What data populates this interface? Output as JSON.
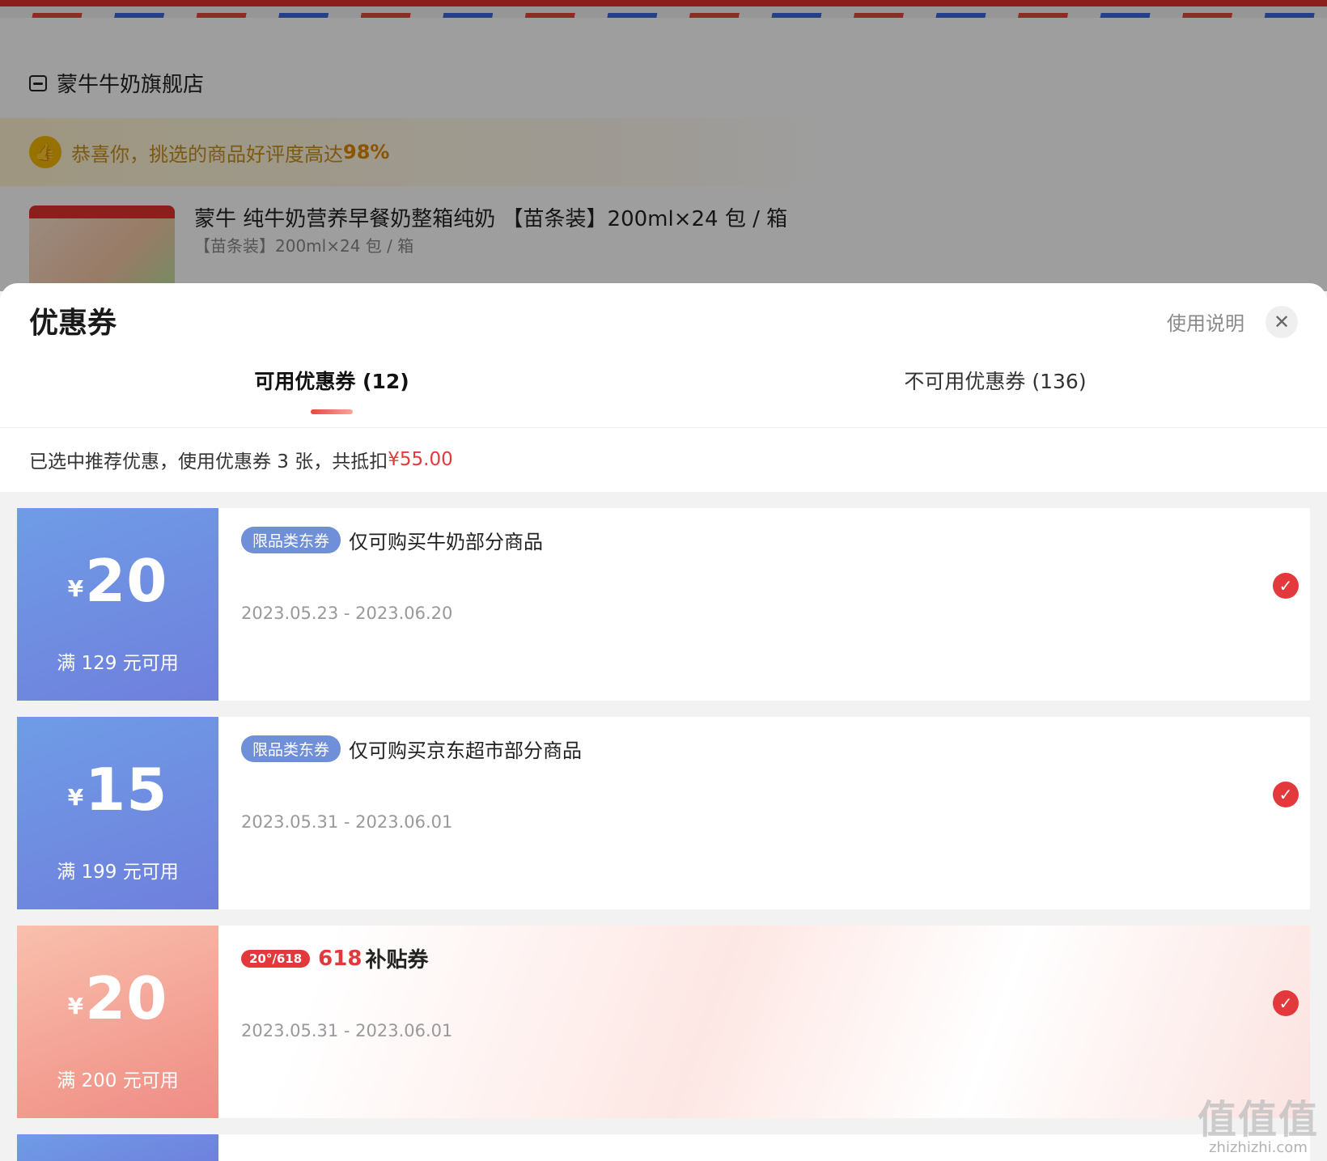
{
  "background": {
    "shop_name": "蒙牛牛奶旗舰店",
    "tip_text": "恭喜你，挑选的商品好评度高达",
    "tip_pct": "98%",
    "product_title": "蒙牛 纯牛奶营养早餐奶整箱纯奶 【苗条装】200ml×24 包 / 箱",
    "product_sub": "【苗条装】200ml×24 包 / 箱"
  },
  "sheet": {
    "title": "优惠券",
    "help_label": "使用说明",
    "close_glyph": "✕"
  },
  "tabs": [
    {
      "label": "可用优惠券 (12)",
      "active": true
    },
    {
      "label": "不可用优惠券 (136)",
      "active": false
    }
  ],
  "summary": {
    "text": "已选中推荐优惠，使用优惠券 3 张，共抵扣",
    "amount": "¥55.00"
  },
  "coupons": [
    {
      "yen": "¥",
      "value": "20",
      "condition": "满 129 元可用",
      "badge": "限品类东券",
      "desc": "仅可购买牛奶部分商品",
      "dates": "2023.05.23 - 2023.06.20",
      "checked": true
    },
    {
      "yen": "¥",
      "value": "15",
      "condition": "满 199 元可用",
      "badge": "限品类东券",
      "desc": "仅可购买京东超市部分商品",
      "dates": "2023.05.31 - 2023.06.01",
      "checked": true
    },
    {
      "yen": "¥",
      "value": "20",
      "condition": "满 200 元可用",
      "badge": "20°/618",
      "badge_618_num": "618",
      "desc": "补贴券",
      "dates": "2023.05.31 - 2023.06.01",
      "checked": true
    }
  ],
  "icons": {
    "check": "✓",
    "thumb": "👍"
  },
  "watermark": {
    "main": "值值值",
    "sub": "zhizhizhi.com"
  },
  "colors": {
    "accent_red": "#e4393c",
    "coupon_blue": "#6f8fd8",
    "coupon_pink": "#f29b8f"
  }
}
